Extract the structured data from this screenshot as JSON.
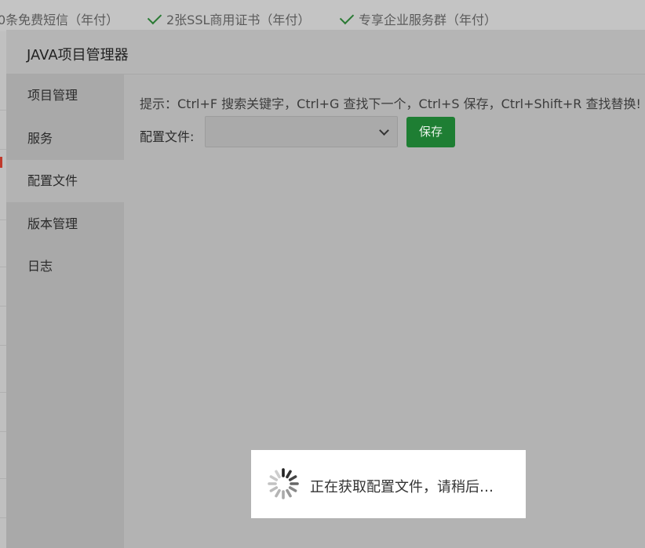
{
  "background": {
    "items": [
      {
        "label": "0条免费短信（年付）"
      },
      {
        "label": "2张SSL商用证书（年付）"
      },
      {
        "label": "专享企业服务群（年付）"
      }
    ]
  },
  "dialog": {
    "title": "JAVA项目管理器",
    "menu": [
      {
        "label": "项目管理",
        "active": false
      },
      {
        "label": "服务",
        "active": false
      },
      {
        "label": "配置文件",
        "active": true
      },
      {
        "label": "版本管理",
        "active": false
      },
      {
        "label": "日志",
        "active": false
      }
    ],
    "tip": "提示：Ctrl+F 搜索关键字，Ctrl+G 查找下一个，Ctrl+S 保存，Ctrl+Shift+R 查找替换!",
    "config_label": "配置文件:",
    "config_select_value": "",
    "save_label": "保存"
  },
  "loading": {
    "text": "正在获取配置文件，请稍后…"
  },
  "colors": {
    "accent": "#1e7e33",
    "check": "#2a7a34"
  }
}
